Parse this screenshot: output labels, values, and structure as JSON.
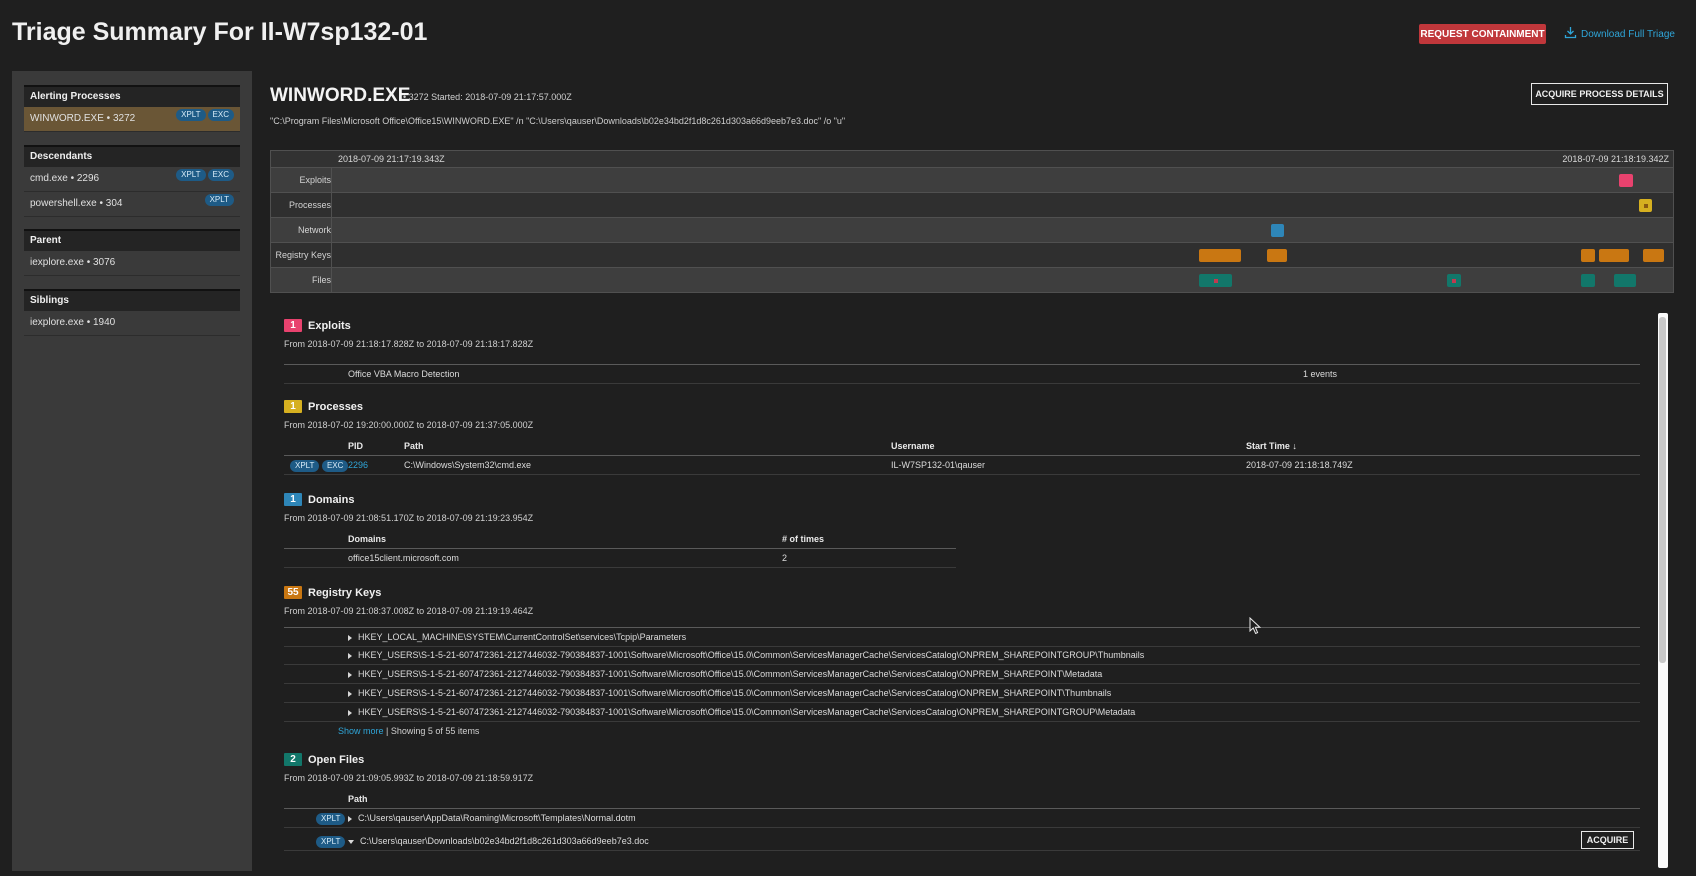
{
  "page": {
    "title": "Triage Summary For Il-W7sp132-01",
    "request_containment": "REQUEST CONTAINMENT",
    "download_full_triage": "Download Full Triage"
  },
  "colors": {
    "exploit": "#e8426e",
    "process": "#d6b020",
    "network": "#2e86b8",
    "registry": "#c97712",
    "files": "#12776a",
    "badge": "#1e5b86",
    "accent": "#2fa5d8"
  },
  "sidebar": {
    "alerting": {
      "header": "Alerting Processes",
      "items": [
        {
          "label": "WINWORD.EXE  •  3272",
          "badges": [
            "XPLT",
            "EXC"
          ]
        }
      ]
    },
    "descendants": {
      "header": "Descendants",
      "items": [
        {
          "label": "cmd.exe  •  2296",
          "badges": [
            "XPLT",
            "EXC"
          ]
        },
        {
          "label": "powershell.exe  •  304",
          "badges": [
            "XPLT"
          ]
        }
      ]
    },
    "parent": {
      "header": "Parent",
      "items": [
        {
          "label": "iexplore.exe  •  3076"
        }
      ]
    },
    "siblings": {
      "header": "Siblings",
      "items": [
        {
          "label": "iexplore.exe  •  1940"
        }
      ]
    }
  },
  "process": {
    "name": "WINWORD.EXE",
    "meta": "• 3272   Started: 2018-07-09 21:17:57.000Z",
    "cmdline": "\"C:\\Program Files\\Microsoft Office\\Office15\\WINWORD.EXE\" /n \"C:\\Users\\qauser\\Downloads\\b02e34bd2f1d8c261d303a66d9eeb7e3.doc\" /o \"u\"",
    "acquire_details": "ACQUIRE PROCESS DETAILS"
  },
  "timeline": {
    "start": "2018-07-09 21:17:19.343Z",
    "end": "2018-07-09 21:18:19.342Z",
    "rows": [
      "Exploits",
      "Processes",
      "Network",
      "Registry Keys",
      "Files"
    ]
  },
  "exploits": {
    "count": "1",
    "title": "Exploits",
    "range": "From 2018-07-09 21:18:17.828Z to 2018-07-09 21:18:17.828Z",
    "rows": [
      {
        "name": "Office VBA Macro Detection",
        "events": "1 events"
      }
    ]
  },
  "processes": {
    "count": "1",
    "title": "Processes",
    "range": "From 2018-07-02 19:20:00.000Z to 2018-07-09 21:37:05.000Z",
    "headers": {
      "pid": "PID",
      "path": "Path",
      "username": "Username",
      "start": "Start Time ↓"
    },
    "rows": [
      {
        "badges": [
          "XPLT",
          "EXC"
        ],
        "pid": "2296",
        "path": "C:\\Windows\\System32\\cmd.exe",
        "username": "IL-W7SP132-01\\qauser",
        "start": "2018-07-09 21:18:18.749Z"
      }
    ]
  },
  "domains": {
    "count": "1",
    "title": "Domains",
    "range": "From 2018-07-09 21:08:51.170Z to 2018-07-09 21:19:23.954Z",
    "headers": {
      "domain": "Domains",
      "times": "# of times"
    },
    "rows": [
      {
        "domain": "office15client.microsoft.com",
        "times": "2"
      }
    ]
  },
  "registry": {
    "count": "55",
    "title": "Registry Keys",
    "range": "From 2018-07-09 21:08:37.008Z to 2018-07-09 21:19:19.464Z",
    "rows": [
      "HKEY_LOCAL_MACHINE\\SYSTEM\\CurrentControlSet\\services\\Tcpip\\Parameters",
      "HKEY_USERS\\S-1-5-21-607472361-2127446032-790384837-1001\\Software\\Microsoft\\Office\\15.0\\Common\\ServicesManagerCache\\ServicesCatalog\\ONPREM_SHAREPOINTGROUP\\Thumbnails",
      "HKEY_USERS\\S-1-5-21-607472361-2127446032-790384837-1001\\Software\\Microsoft\\Office\\15.0\\Common\\ServicesManagerCache\\ServicesCatalog\\ONPREM_SHAREPOINT\\Metadata",
      "HKEY_USERS\\S-1-5-21-607472361-2127446032-790384837-1001\\Software\\Microsoft\\Office\\15.0\\Common\\ServicesManagerCache\\ServicesCatalog\\ONPREM_SHAREPOINT\\Thumbnails",
      "HKEY_USERS\\S-1-5-21-607472361-2127446032-790384837-1001\\Software\\Microsoft\\Office\\15.0\\Common\\ServicesManagerCache\\ServicesCatalog\\ONPREM_SHAREPOINTGROUP\\Metadata"
    ],
    "show_more": "Show more",
    "showing": "| Showing 5 of 55 items"
  },
  "files": {
    "count": "2",
    "title": "Open Files",
    "range": "From 2018-07-09 21:09:05.993Z to 2018-07-09 21:18:59.917Z",
    "header_path": "Path",
    "rows": [
      {
        "badge": "XPLT",
        "path": "C:\\Users\\qauser\\AppData\\Roaming\\Microsoft\\Templates\\Normal.dotm"
      },
      {
        "badge": "XPLT",
        "path": "C:\\Users\\qauser\\Downloads\\b02e34bd2f1d8c261d303a66d9eeb7e3.doc",
        "action": "ACQUIRE"
      }
    ]
  }
}
